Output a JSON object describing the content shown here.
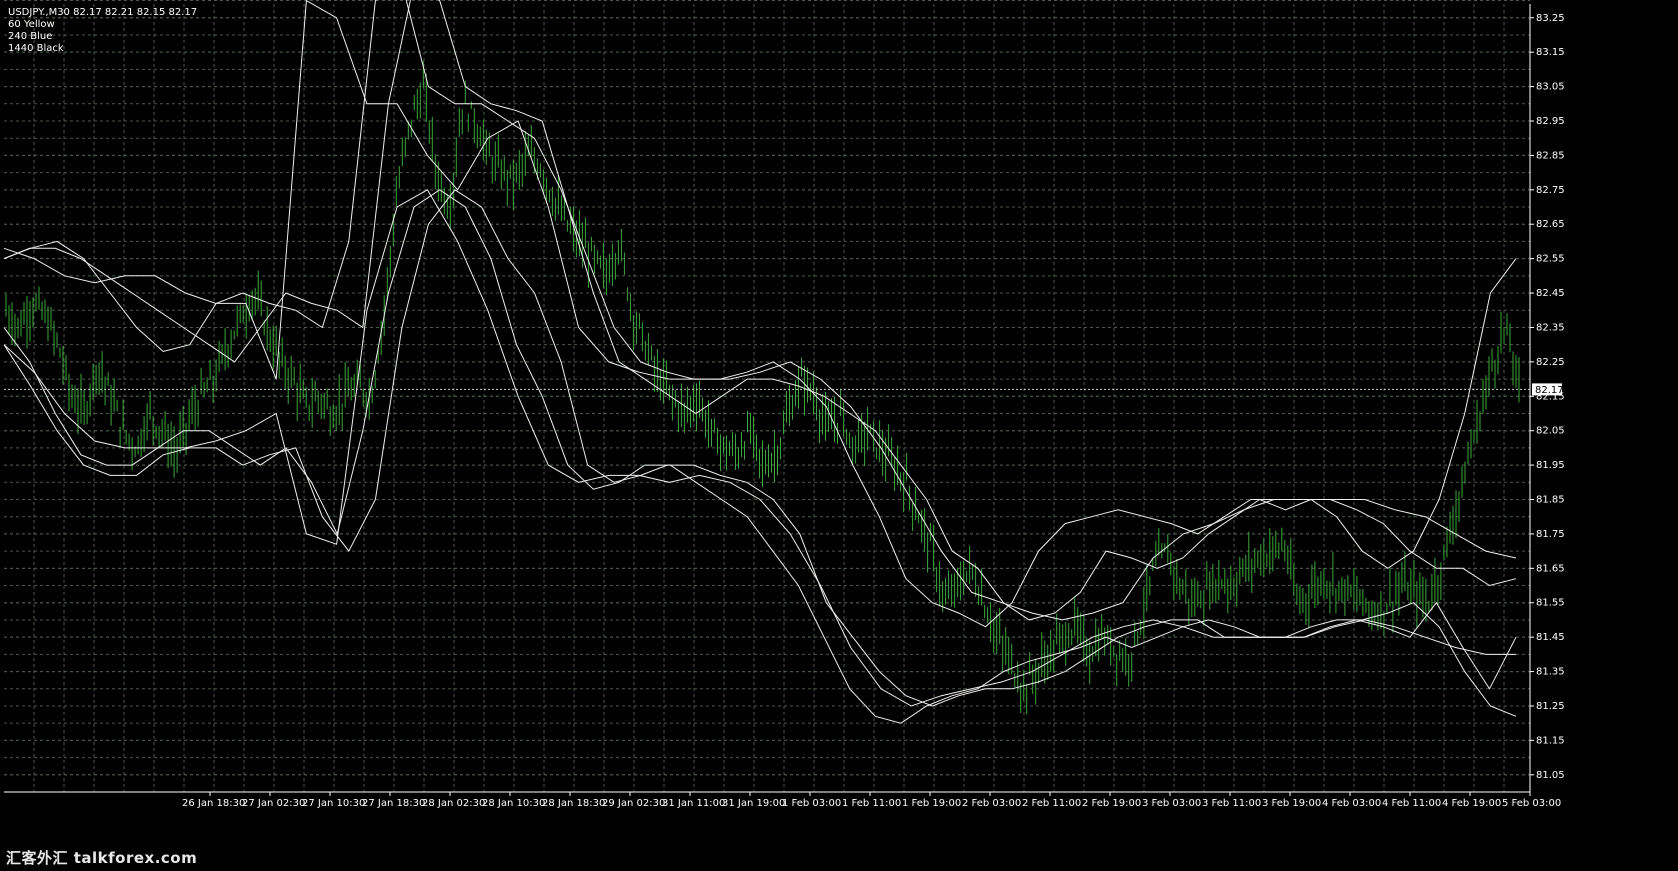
{
  "header": {
    "symbol_line": "USDJPY.,M30  82.17 82.21 82.15 82.17",
    "legend": [
      "60 Yellow",
      "240 Blue",
      "1440 Black"
    ]
  },
  "watermark": "汇客外汇 talkforex.com",
  "colors": {
    "background": "#000000",
    "grid": "#4a5a4a",
    "bars": "#3da63d",
    "bands": "#f0f0f0",
    "price_box": "#ffffff"
  },
  "chart_data": {
    "type": "candlestick",
    "symbol": "USDJPY.",
    "timeframe": "M30",
    "last_price": 82.17,
    "last_price_label": "82.17",
    "ylim": [
      81.0,
      83.3
    ],
    "y_ticks": [
      "83.25",
      "83.15",
      "83.05",
      "82.95",
      "82.85",
      "82.75",
      "82.65",
      "82.55",
      "82.45",
      "82.35",
      "82.25",
      "82.15",
      "82.05",
      "81.95",
      "81.85",
      "81.75",
      "81.65",
      "81.55",
      "81.45",
      "81.35",
      "81.25",
      "81.15",
      "81.05"
    ],
    "x_ticks": [
      "26 Jan 18:30",
      "27 Jan 02:30",
      "27 Jan 10:30",
      "27 Jan 18:30",
      "28 Jan 02:30",
      "28 Jan 10:30",
      "28 Jan 18:30",
      "29 Jan 02:30",
      "31 Jan 11:00",
      "31 Jan 19:00",
      "1 Feb 03:00",
      "1 Feb 11:00",
      "1 Feb 19:00",
      "2 Feb 03:00",
      "2 Feb 11:00",
      "2 Feb 19:00",
      "3 Feb 03:00",
      "3 Feb 11:00",
      "3 Feb 19:00",
      "4 Feb 03:00",
      "4 Feb 11:00",
      "4 Feb 19:00",
      "5 Feb 03:00"
    ],
    "close_path": [
      82.4,
      82.35,
      82.42,
      82.38,
      82.3,
      82.15,
      82.1,
      82.25,
      82.15,
      82.05,
      82.0,
      82.1,
      82.05,
      81.98,
      82.08,
      82.15,
      82.2,
      82.3,
      82.38,
      82.45,
      82.35,
      82.25,
      82.2,
      82.12,
      82.15,
      82.1,
      82.15,
      82.18,
      82.15,
      82.4,
      82.75,
      82.95,
      83.05,
      82.8,
      82.7,
      83.0,
      82.95,
      82.85,
      82.8,
      82.78,
      82.85,
      82.82,
      82.72,
      82.65,
      82.6,
      82.55,
      82.5,
      82.6,
      82.4,
      82.3,
      82.2,
      82.15,
      82.1,
      82.15,
      82.05,
      82.0,
      81.98,
      82.05,
      81.95,
      81.98,
      82.1,
      82.2,
      82.15,
      82.05,
      82.1,
      82.0,
      82.05,
      82.0,
      81.95,
      81.9,
      81.8,
      81.7,
      81.55,
      81.6,
      81.65,
      81.55,
      81.45,
      81.38,
      81.3,
      81.35,
      81.4,
      81.45,
      81.48,
      81.4,
      81.45,
      81.42,
      81.38,
      81.5,
      81.65,
      81.7,
      81.6,
      81.55,
      81.58,
      81.62,
      81.6,
      81.65,
      81.68,
      81.7,
      81.72,
      81.55,
      81.58,
      81.62,
      81.6,
      81.58,
      81.55,
      81.52,
      81.55,
      81.6,
      81.58,
      81.55,
      81.65,
      81.8,
      81.95,
      82.1,
      82.25,
      82.35,
      82.17
    ],
    "bands_60": {
      "upper": [
        82.55,
        82.58,
        82.58,
        82.55,
        82.5,
        82.45,
        82.4,
        82.35,
        82.3,
        82.25,
        82.35,
        82.45,
        82.42,
        82.4,
        82.35,
        83.0,
        83.35,
        83.3,
        83.05,
        83.0,
        82.98,
        82.95,
        82.7,
        82.45,
        82.25,
        82.2,
        82.15,
        82.1,
        82.15,
        82.2,
        82.2,
        82.18,
        82.15,
        82.1,
        82.05,
        81.95,
        81.85,
        81.7,
        81.65,
        81.55,
        81.5,
        81.52,
        81.58,
        81.7,
        81.68,
        81.65,
        81.68,
        81.75,
        81.8,
        81.85,
        81.82,
        81.85,
        81.8,
        81.7,
        81.65,
        81.7,
        81.85,
        82.1,
        82.45,
        82.55
      ],
      "lower": [
        82.35,
        82.25,
        82.1,
        81.98,
        81.95,
        81.95,
        82.0,
        82.05,
        82.05,
        82.0,
        81.95,
        82.0,
        81.9,
        81.75,
        82.05,
        82.45,
        82.7,
        82.75,
        82.7,
        82.55,
        82.3,
        82.15,
        81.95,
        81.88,
        81.9,
        81.95,
        81.95,
        81.9,
        81.85,
        81.8,
        81.7,
        81.6,
        81.45,
        81.3,
        81.22,
        81.2,
        81.25,
        81.28,
        81.3,
        81.35,
        81.38,
        81.4,
        81.42,
        81.45,
        81.42,
        81.45,
        81.48,
        81.5,
        81.48,
        81.45,
        81.45,
        81.48,
        81.5,
        81.5,
        81.52,
        81.55,
        81.48,
        81.35,
        81.25,
        81.22
      ]
    },
    "bands_240": {
      "upper": [
        82.55,
        82.58,
        82.6,
        82.55,
        82.45,
        82.35,
        82.28,
        82.3,
        82.42,
        82.45,
        82.42,
        82.4,
        82.35,
        82.6,
        83.3,
        83.35,
        83.05,
        83.0,
        83.0,
        82.95,
        82.9,
        82.75,
        82.55,
        82.35,
        82.25,
        82.22,
        82.2,
        82.2,
        82.22,
        82.25,
        82.2,
        82.12,
        81.95,
        81.8,
        81.62,
        81.55,
        81.52,
        81.48,
        81.55,
        81.7,
        81.78,
        81.8,
        81.82,
        81.8,
        81.78,
        81.75,
        81.8,
        81.85,
        81.85,
        81.85,
        81.85,
        81.82,
        81.78,
        81.7,
        81.65,
        81.65,
        81.6,
        81.62
      ],
      "lower": [
        82.3,
        82.18,
        82.05,
        81.95,
        81.92,
        81.92,
        81.98,
        82.0,
        82.0,
        81.95,
        81.98,
        82.0,
        81.8,
        81.7,
        81.85,
        82.35,
        82.65,
        82.75,
        82.7,
        82.55,
        82.45,
        82.25,
        81.95,
        81.9,
        81.92,
        81.95,
        81.95,
        81.92,
        81.9,
        81.85,
        81.75,
        81.55,
        81.45,
        81.35,
        81.28,
        81.25,
        81.28,
        81.3,
        81.3,
        81.32,
        81.35,
        81.4,
        81.45,
        81.48,
        81.5,
        81.5,
        81.45,
        81.45,
        81.45,
        81.45,
        81.48,
        81.5,
        81.48,
        81.45,
        81.55,
        81.42,
        81.3,
        81.45
      ]
    },
    "bands_1440": {
      "upper": [
        82.58,
        82.55,
        82.5,
        82.48,
        82.5,
        82.5,
        82.45,
        82.42,
        82.42,
        82.2,
        83.3,
        83.25,
        83.0,
        83.0,
        82.85,
        82.75,
        82.9,
        82.95,
        82.7,
        82.35,
        82.25,
        82.22,
        82.2,
        82.2,
        82.2,
        82.22,
        82.25,
        82.2,
        82.12,
        82.0,
        81.85,
        81.7,
        81.58,
        81.55,
        81.52,
        81.5,
        81.52,
        81.55,
        81.68,
        81.75,
        81.78,
        81.82,
        81.85,
        81.85,
        81.85,
        81.85,
        81.82,
        81.8,
        81.75,
        81.7,
        81.68
      ],
      "lower": [
        82.3,
        82.22,
        82.1,
        82.02,
        82.0,
        82.0,
        82.0,
        82.02,
        82.05,
        82.1,
        81.75,
        81.72,
        82.4,
        82.7,
        82.75,
        82.6,
        82.4,
        82.15,
        81.95,
        81.9,
        81.92,
        81.92,
        81.9,
        81.92,
        81.9,
        81.85,
        81.75,
        81.6,
        81.42,
        81.3,
        81.25,
        81.28,
        81.3,
        81.32,
        81.35,
        81.4,
        81.45,
        81.48,
        81.5,
        81.48,
        81.45,
        81.45,
        81.45,
        81.45,
        81.48,
        81.5,
        81.48,
        81.45,
        81.42,
        81.4,
        81.4
      ]
    }
  }
}
